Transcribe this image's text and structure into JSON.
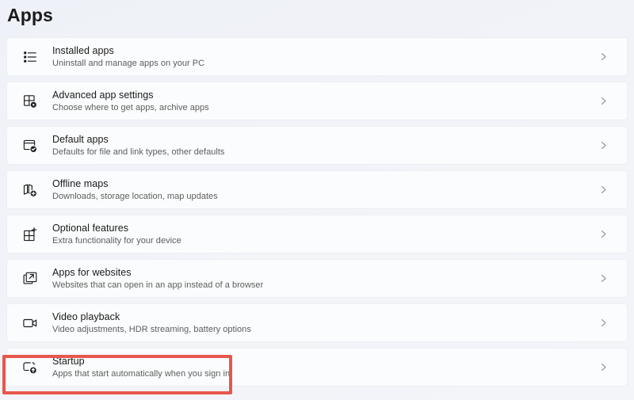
{
  "page": {
    "title": "Apps"
  },
  "settings_list": [
    {
      "icon": "installed-apps-icon",
      "title": "Installed apps",
      "subtitle": "Uninstall and manage apps on your PC"
    },
    {
      "icon": "advanced-app-settings-icon",
      "title": "Advanced app settings",
      "subtitle": "Choose where to get apps, archive apps"
    },
    {
      "icon": "default-apps-icon",
      "title": "Default apps",
      "subtitle": "Defaults for file and link types, other defaults"
    },
    {
      "icon": "offline-maps-icon",
      "title": "Offline maps",
      "subtitle": "Downloads, storage location, map updates"
    },
    {
      "icon": "optional-features-icon",
      "title": "Optional features",
      "subtitle": "Extra functionality for your device"
    },
    {
      "icon": "apps-for-websites-icon",
      "title": "Apps for websites",
      "subtitle": "Websites that can open in an app instead of a browser"
    },
    {
      "icon": "video-playback-icon",
      "title": "Video playback",
      "subtitle": "Video adjustments, HDR streaming, battery options"
    },
    {
      "icon": "startup-icon",
      "title": "Startup",
      "subtitle": "Apps that start automatically when you sign in"
    }
  ],
  "annotation": {
    "target_title": "Startup",
    "color": "#e8574b"
  },
  "colors": {
    "background": "#f1f3f8",
    "card_background": "#fbfcfd",
    "title_text": "#1a1a1a",
    "subtitle_text": "#5d5d5d",
    "chevron": "#9b9ba1",
    "highlight": "#e8574b"
  },
  "icons": {
    "chevron_right": "chevron-right-icon"
  }
}
